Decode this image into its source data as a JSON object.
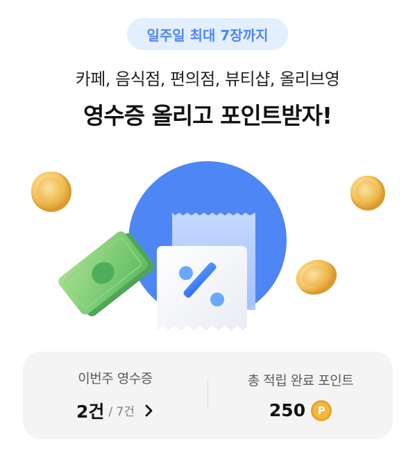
{
  "badge": {
    "label": "일주일 최대 7장까지"
  },
  "header": {
    "subtitle": "카페, 음식점, 편의점, 뷰티샵, 올리브영",
    "title": "영수증 올리고 포인트받자!"
  },
  "illustration": {
    "percent_symbol": "%",
    "colors": {
      "circle": "#4f86f5",
      "coin": "#f3c25a",
      "bill": "#7ccf73"
    }
  },
  "stats": {
    "weekly": {
      "label": "이번주 영수증",
      "value": "2건",
      "max": "/ 7건"
    },
    "points": {
      "label": "총 적립 완료 포인트",
      "value": "250",
      "coin_label": "P"
    }
  },
  "icons": {
    "chevron": "chevron-right-icon",
    "coin": "point-coin-icon"
  }
}
